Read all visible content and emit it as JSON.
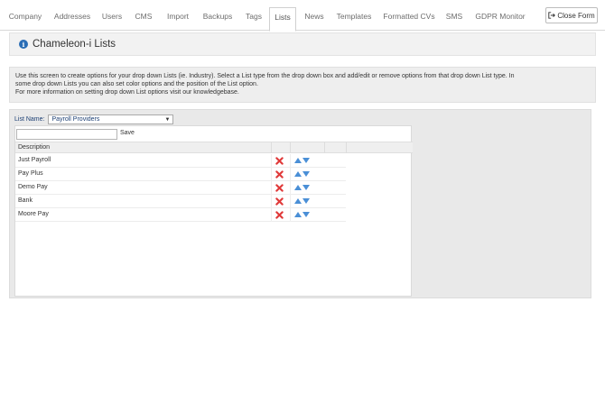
{
  "tabs": [
    {
      "label": "Company",
      "active": false
    },
    {
      "label": "Addresses",
      "active": false
    },
    {
      "label": "Users",
      "active": false
    },
    {
      "label": "CMS",
      "active": false
    },
    {
      "label": "Import",
      "active": false
    },
    {
      "label": "Backups",
      "active": false
    },
    {
      "label": "Tags",
      "active": false
    },
    {
      "label": "Lists",
      "active": true
    },
    {
      "label": "News",
      "active": false
    },
    {
      "label": "Templates",
      "active": false
    },
    {
      "label": "Formatted CVs",
      "active": false
    },
    {
      "label": "SMS",
      "active": false
    },
    {
      "label": "GDPR Monitor",
      "active": false
    }
  ],
  "close_form_label": "Close Form",
  "page_title": "Chameleon-i Lists",
  "info": {
    "line1": "Use this screen to create options for your drop down Lists (ie. Industry). Select a List type from the drop down box and add/edit or remove options from that drop down List type. In",
    "line2": "some drop down Lists you can also set color options and the position of the List option.",
    "line3": "For more information on setting drop down List options visit our knowledgebase."
  },
  "list_name_label": "List Name:",
  "list_name_value": "Payroll Providers",
  "new_option_value": "",
  "save_label": "Save",
  "grid": {
    "header_description": "Description",
    "rows": [
      {
        "description": "Just Payroll"
      },
      {
        "description": "Pay Plus"
      },
      {
        "description": "Demo Pay"
      },
      {
        "description": "Bank"
      },
      {
        "description": "Moore Pay"
      }
    ]
  },
  "colors": {
    "delete": "#e03a3a",
    "arrow": "#4a8fd6",
    "info_icon": "#2a6db5",
    "select_text": "#1c3f74"
  }
}
